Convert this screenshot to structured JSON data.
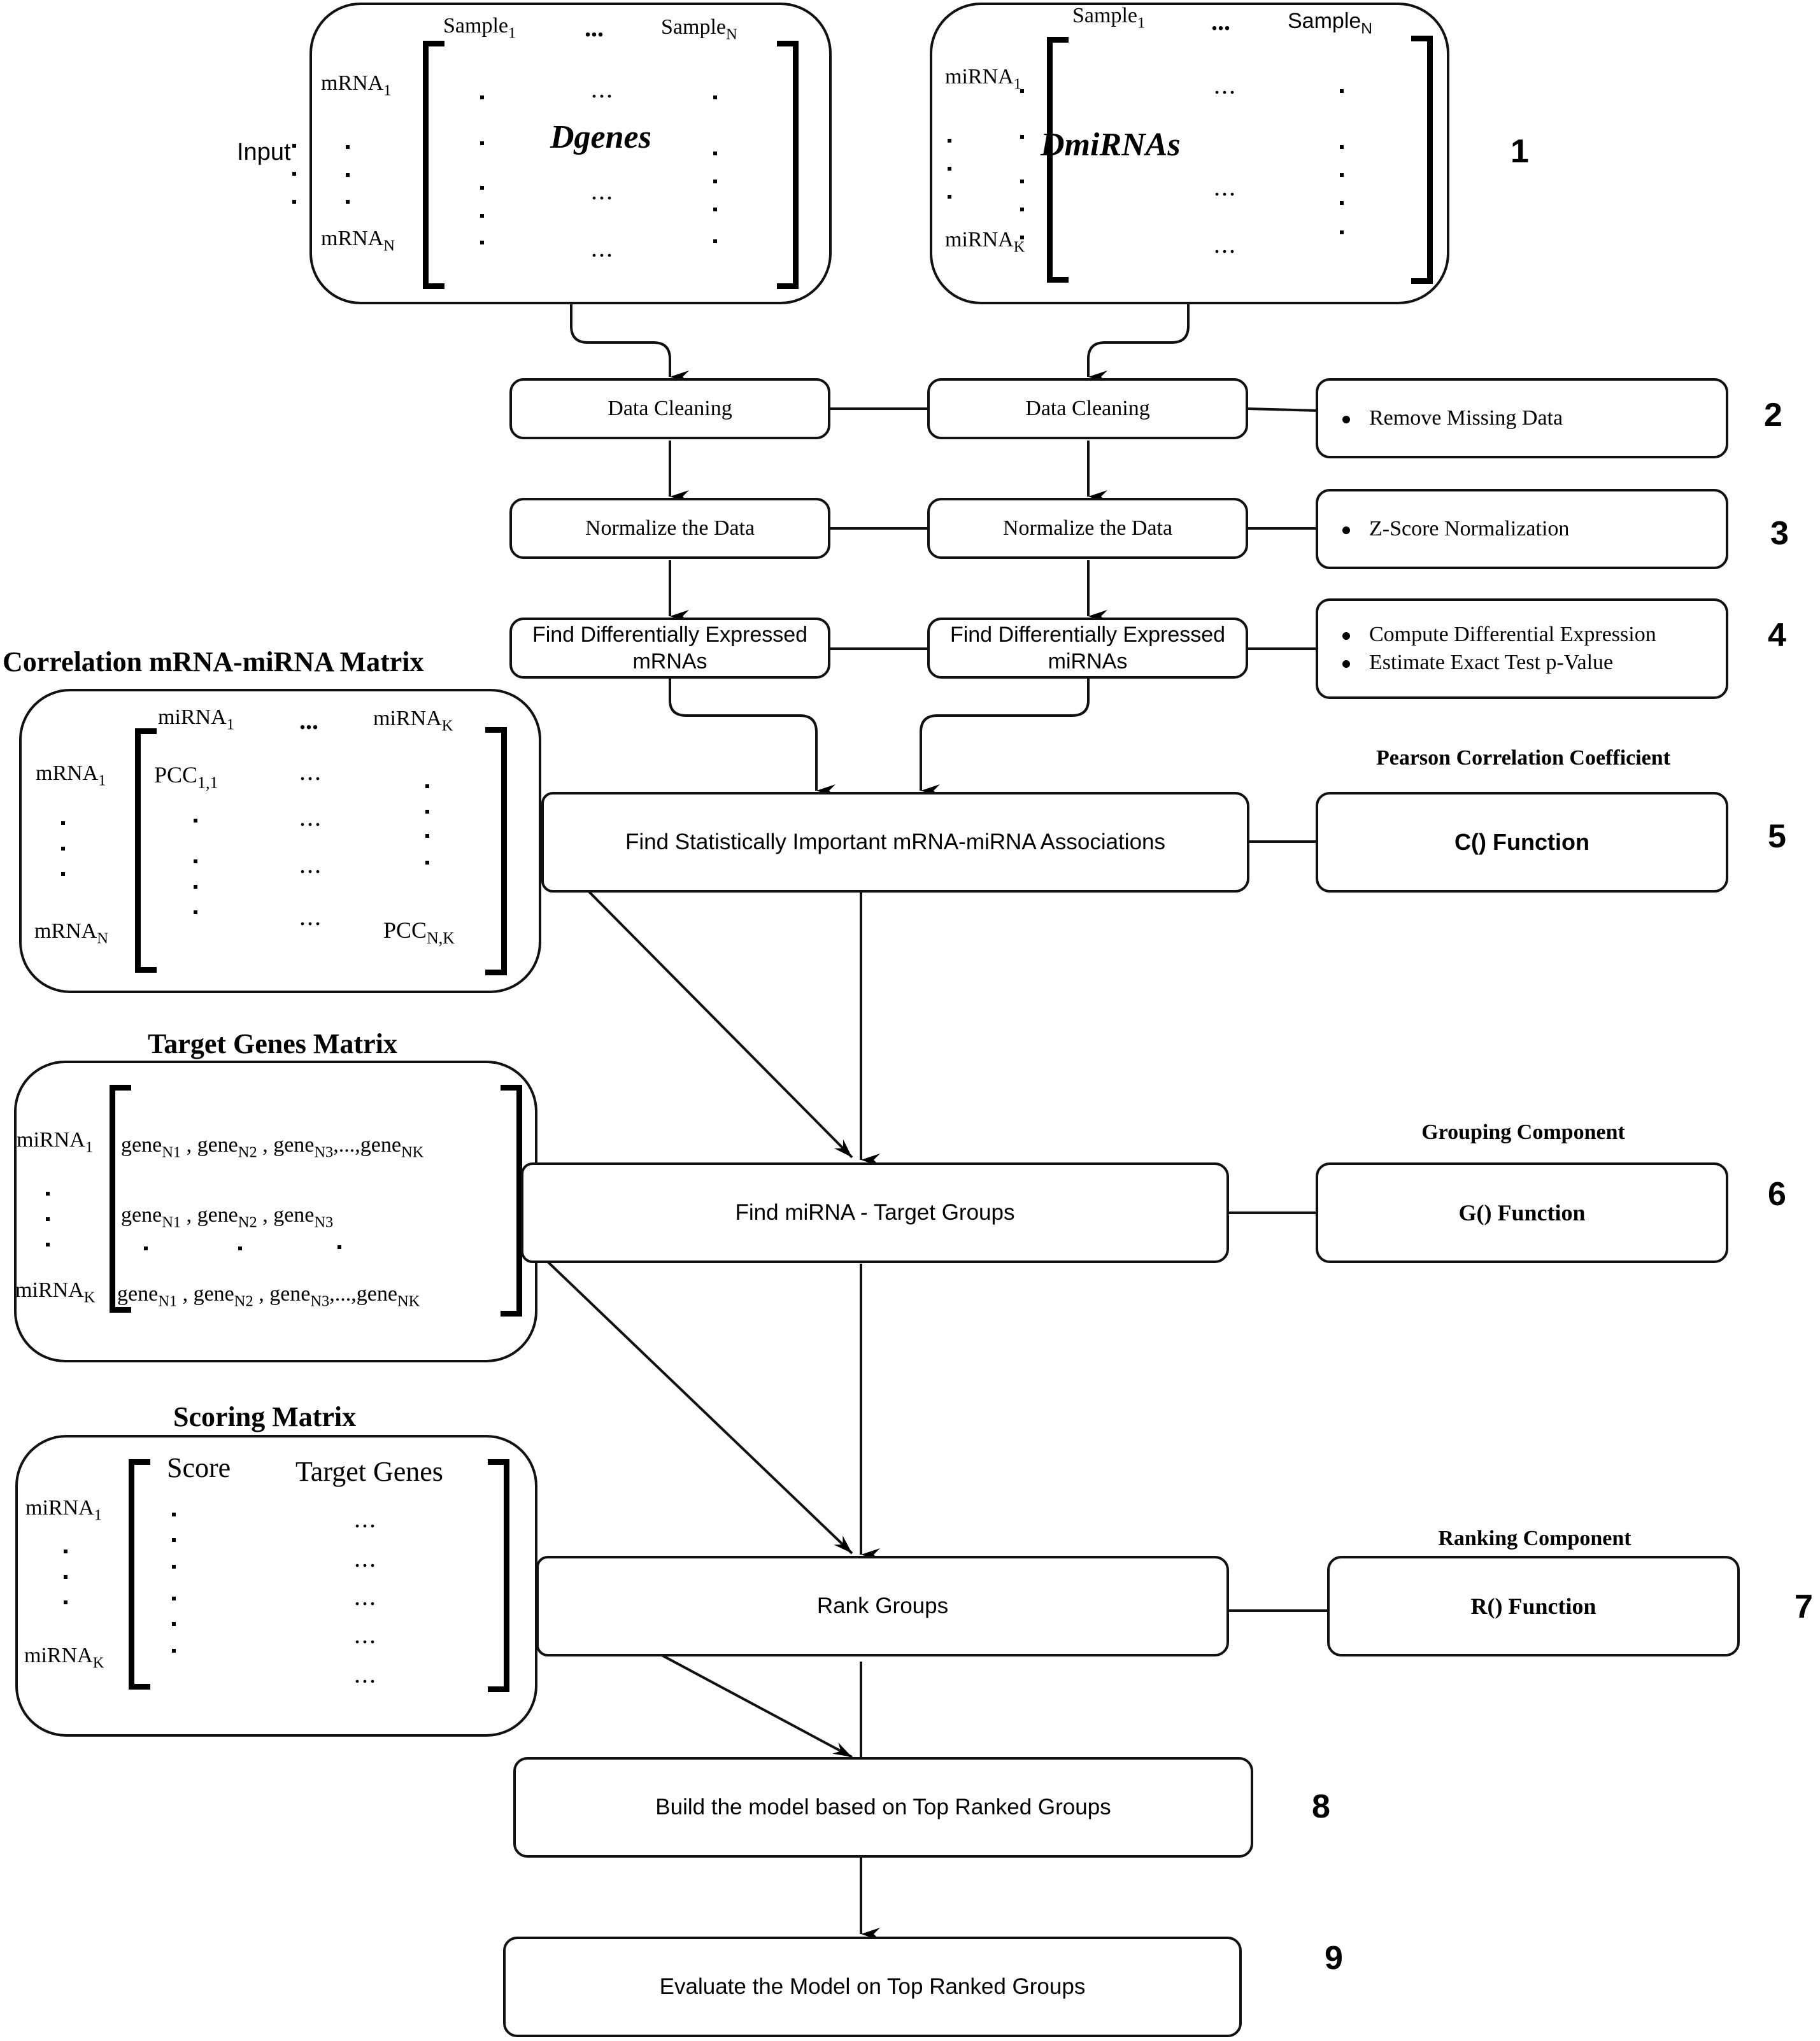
{
  "input_label": "Input",
  "genes_matrix": {
    "name": "Dgenes",
    "col_first": "Sample",
    "col_first_sub": "1",
    "col_ellipsis": "...",
    "col_last": "Sample",
    "col_last_sub": "N",
    "row_first": "mRNA",
    "row_first_sub": "1",
    "row_last": "mRNA",
    "row_last_sub": "N",
    "cell_ellipsis": "..."
  },
  "mirna_matrix": {
    "name": "DmiRNAs",
    "col_first": "Sample",
    "col_first_sub": "1",
    "col_ellipsis": "...",
    "col_last": "Sample",
    "col_last_sub": "N",
    "row_first": "miRNA",
    "row_first_sub": "1",
    "row_last": "miRNA",
    "row_last_sub": "K",
    "cell_ellipsis": "..."
  },
  "steps": {
    "s1": "1",
    "s2": "2",
    "s3": "3",
    "s4": "4",
    "s5": "5",
    "s6": "6",
    "s7": "7",
    "s8": "8",
    "s9": "9"
  },
  "left_column": {
    "cleaning": "Data Cleaning",
    "normalize": "Normalize the Data",
    "diff_line1": "Find Differentially Expressed",
    "diff_line2": "mRNAs"
  },
  "right_column": {
    "cleaning": "Data Cleaning",
    "normalize": "Normalize the Data",
    "diff_line1": "Find Differentially Expressed",
    "diff_line2": "miRNAs"
  },
  "notes": {
    "cleaning": [
      "Remove Missing Data"
    ],
    "normalize": [
      "Z-Score Normalization"
    ],
    "diff": [
      "Compute Differential Expression",
      "Estimate Exact Test p-Value"
    ]
  },
  "correlation_matrix": {
    "title": "Correlation mRNA-miRNA Matrix",
    "col_first": "miRNA",
    "col_first_sub": "1",
    "col_ellipsis": "...",
    "col_last": "miRNA",
    "col_last_sub": "K",
    "row_first": "mRNA",
    "row_first_sub": "1",
    "row_last": "mRNA",
    "row_last_sub": "N",
    "first_cell": "PCC",
    "first_cell_sub": "1,1",
    "last_cell": "PCC",
    "last_cell_sub": "N,K",
    "cell_ellipsis": "..."
  },
  "associations_box": "Find Statistically Important mRNA-miRNA Associations",
  "correlation_component": {
    "title": "Pearson Correlation Coefficient",
    "function": "C() Function"
  },
  "target_matrix": {
    "title": "Target Genes Matrix",
    "row_first": "miRNA",
    "row_first_sub": "1",
    "row_last": "miRNA",
    "row_last_sub": "K",
    "gene": "gene",
    "sub_n1": "N1",
    "sub_n2": "N2",
    "sub_n3": "N3",
    "sub_nk": "NK",
    "sep": " , ",
    "tail_sep": ",...,"
  },
  "groups_box": "Find miRNA - Target Groups",
  "grouping_component": {
    "title": "Grouping Component",
    "function": "G() Function"
  },
  "scoring_matrix": {
    "title": "Scoring Matrix",
    "col_score": "Score",
    "col_targets": "Target Genes",
    "row_first": "miRNA",
    "row_first_sub": "1",
    "row_last": "miRNA",
    "row_last_sub": "K",
    "cell_ellipsis": "..."
  },
  "rank_box": "Rank Groups",
  "ranking_component": {
    "title": "Ranking Component",
    "function": "R() Function"
  },
  "build_box": "Build the model based on Top Ranked Groups",
  "evaluate_box": "Evaluate the Model on Top Ranked Groups"
}
